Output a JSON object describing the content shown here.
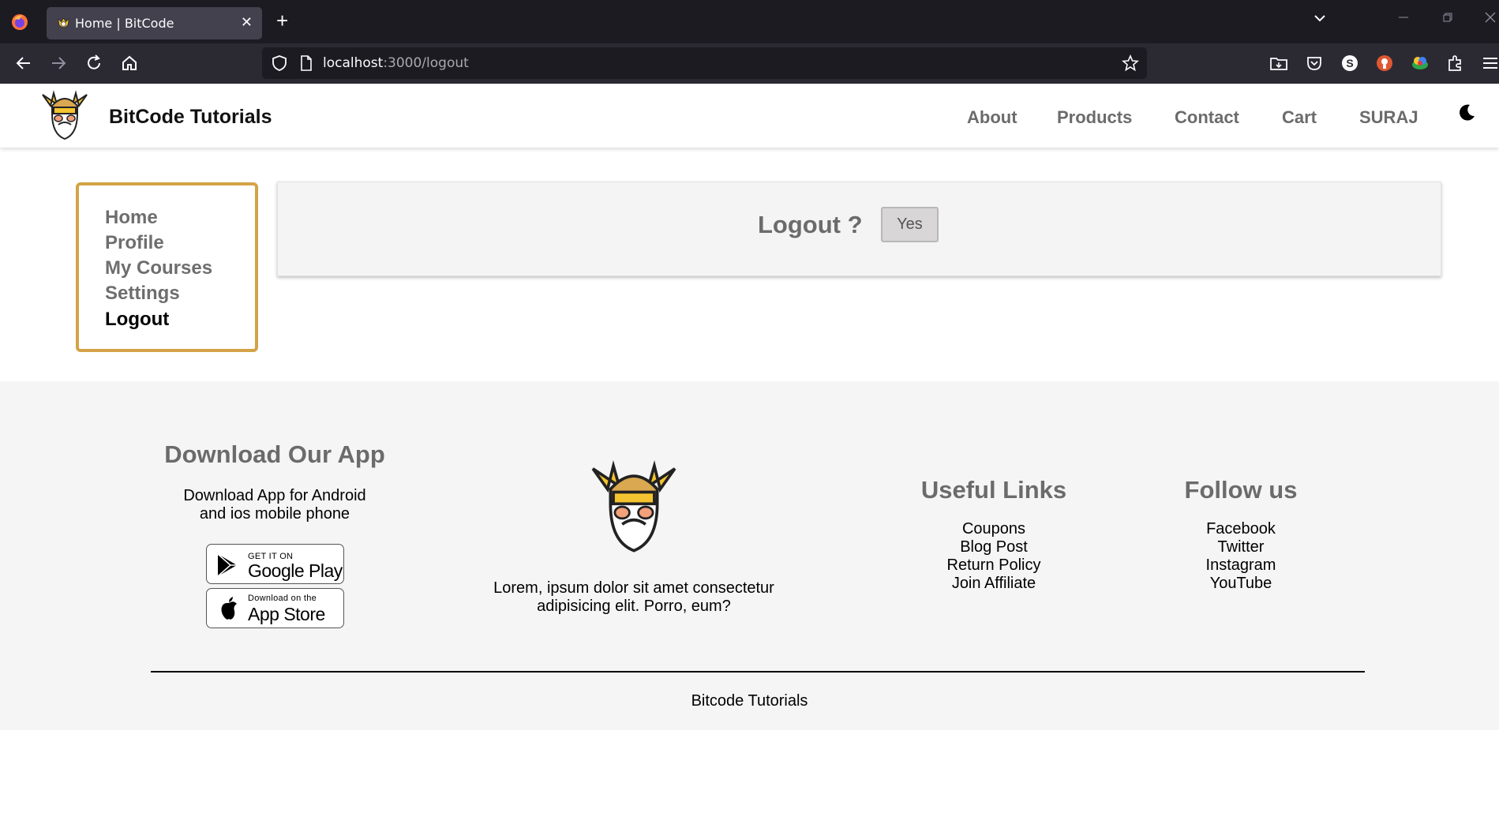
{
  "browser": {
    "tab_title": "Home | BitCode",
    "url_host": "localhost",
    "url_path": ":3000/logout"
  },
  "header": {
    "brand": "BitCode Tutorials",
    "nav": [
      "About",
      "Products",
      "Contact",
      "Cart",
      "SURAJ"
    ]
  },
  "sidebar": {
    "items": [
      {
        "label": "Home",
        "active": false
      },
      {
        "label": "Profile",
        "active": false
      },
      {
        "label": "My Courses",
        "active": false
      },
      {
        "label": "Settings",
        "active": false
      },
      {
        "label": "Logout",
        "active": true
      }
    ]
  },
  "logout": {
    "question": "Logout ?",
    "yes_label": "Yes"
  },
  "footer": {
    "app": {
      "heading": "Download Our App",
      "text_line1": "Download App for Android",
      "text_line2": "and ios mobile phone",
      "google_small": "GET IT ON",
      "google_big": "Google Play",
      "apple_small": "Download on the",
      "apple_big": "App Store"
    },
    "about": {
      "text_line1": "Lorem, ipsum dolor sit amet consectetur",
      "text_line2": "adipisicing elit. Porro, eum?"
    },
    "useful_links": {
      "heading": "Useful Links",
      "links": [
        "Coupons",
        "Blog Post",
        "Return Policy",
        "Join Affiliate"
      ]
    },
    "follow": {
      "heading": "Follow us",
      "links": [
        "Facebook",
        "Twitter",
        "Instagram",
        "YouTube"
      ]
    },
    "copyright": "Bitcode Tutorials"
  },
  "colors": {
    "sidebar_border": "#d4a347",
    "logo_gold": "#f4c430"
  }
}
